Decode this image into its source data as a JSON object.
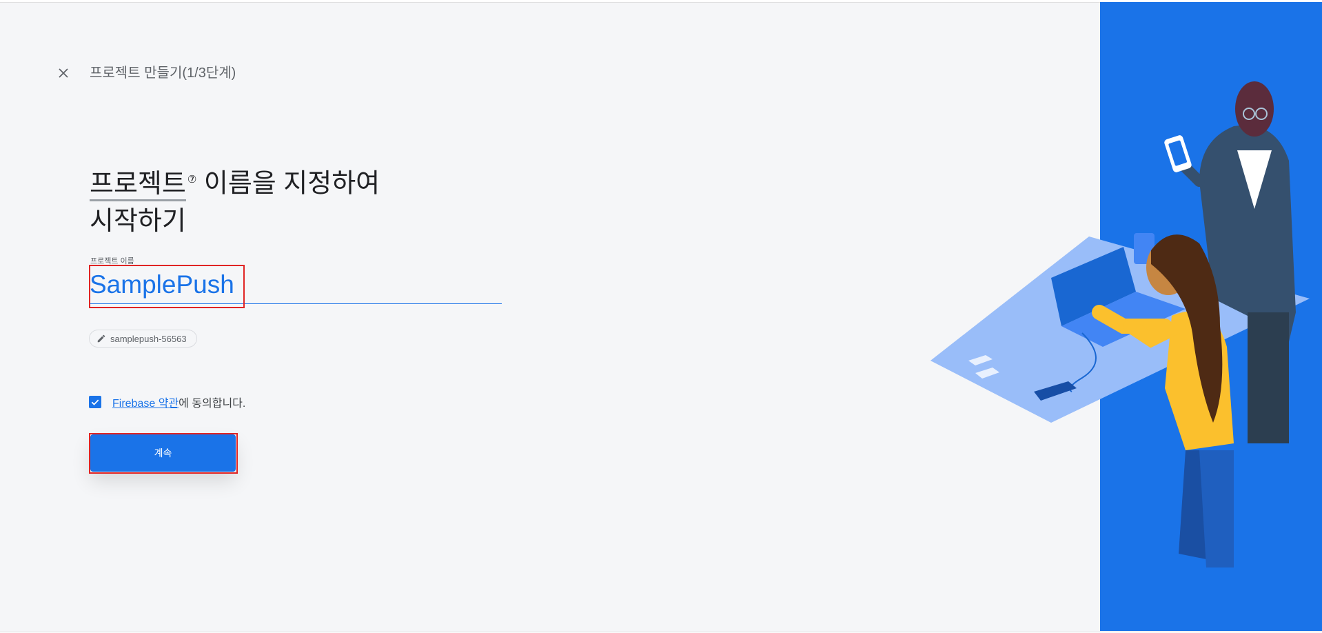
{
  "header": {
    "close_icon": "close-icon",
    "step_title": "프로젝트 만들기(1/3단계)"
  },
  "headline": {
    "term": "프로젝트",
    "help_icon": "help-circle-icon",
    "rest": " 이름을 지정하여",
    "line2": "시작하기"
  },
  "form": {
    "name_label": "프로젝트 이름",
    "name_value": "SamplePush",
    "project_id": "samplepush-56563",
    "edit_icon": "pencil-icon"
  },
  "terms": {
    "checked": true,
    "link_text": "Firebase 약관",
    "suffix": "에 동의합니다."
  },
  "actions": {
    "continue_label": "계속"
  },
  "colors": {
    "accent": "#1a73e8",
    "highlight": "#e02424",
    "illustration_bg": "#1a73e8"
  }
}
